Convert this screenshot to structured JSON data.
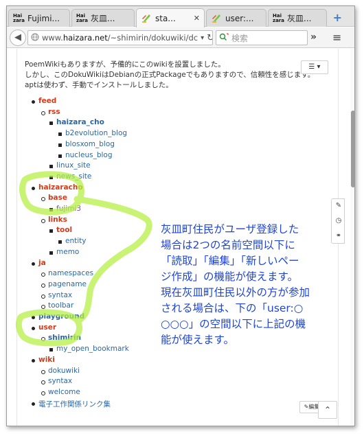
{
  "browser": {
    "tabs": [
      {
        "favicon": "haizara-icon",
        "favicon_text": [
          "Hai",
          "zara"
        ],
        "label": "Fujimi...",
        "active": false
      },
      {
        "favicon": "haizara-icon",
        "favicon_text": [
          "Hai",
          "zara"
        ],
        "label": "灰皿...",
        "active": false
      },
      {
        "favicon": "wiki-icon",
        "label": "sta...",
        "active": true
      },
      {
        "favicon": "wiki-icon",
        "label": "user:...",
        "active": false
      },
      {
        "favicon": "haizara-icon",
        "favicon_text": [
          "Hai",
          "zara"
        ],
        "label": "灰皿...",
        "active": false
      }
    ],
    "tab_close": "✕",
    "new_tab": "+",
    "url_prefix": "www.",
    "url_host": "haizara.net",
    "url_path": "/~shimirin/dokuwiki/dc",
    "search_placeholder": "検索",
    "more": "»",
    "menu": "≡"
  },
  "page": {
    "intro_lines": [
      "PoemWikiもありますが、予備的にこのwikiを設置しました。",
      "しかし、このDokuWikiはDebianの正式Packageでもありますので、信頼性を感じます。",
      "aptは使わず、手動でインストールしました。"
    ],
    "toc_button": "☰ ▾",
    "edit_button": "✎編集",
    "top_button": "⌃"
  },
  "tree": [
    {
      "level": 1,
      "label": "feed",
      "style": "red"
    },
    {
      "level": 2,
      "label": "rss",
      "style": "red"
    },
    {
      "level": 3,
      "label": "haizara_cho",
      "style": "blue-bold"
    },
    {
      "level": 4,
      "label": "b2evolution_blog",
      "style": "blue"
    },
    {
      "level": 4,
      "label": "blosxom_blog",
      "style": "blue"
    },
    {
      "level": 4,
      "label": "nucleus_blog",
      "style": "blue"
    },
    {
      "level": 3,
      "label": "linux_site",
      "style": "blue"
    },
    {
      "level": 3,
      "label": "news_site",
      "style": "blue"
    },
    {
      "level": 1,
      "label": "haizaracho",
      "style": "red"
    },
    {
      "level": 2,
      "label": "base",
      "style": "red"
    },
    {
      "level": 3,
      "label": "fujimi3",
      "style": "purple"
    },
    {
      "level": 2,
      "label": "links",
      "style": "red"
    },
    {
      "level": 3,
      "label": "tool",
      "style": "red"
    },
    {
      "level": 4,
      "label": "entity",
      "style": "blue"
    },
    {
      "level": 3,
      "label": "memo",
      "style": "blue"
    },
    {
      "level": 1,
      "label": "ja",
      "style": "red"
    },
    {
      "level": 2,
      "label": "namespaces",
      "style": "blue"
    },
    {
      "level": 2,
      "label": "pagename",
      "style": "blue"
    },
    {
      "level": 2,
      "label": "syntax",
      "style": "blue"
    },
    {
      "level": 2,
      "label": "toolbar",
      "style": "blue"
    },
    {
      "level": 1,
      "label": "playground",
      "style": "blue-bold"
    },
    {
      "level": 1,
      "label": "user",
      "style": "red"
    },
    {
      "level": 2,
      "label": "shimirin",
      "style": "blue-bold"
    },
    {
      "level": 3,
      "label": "my_open_bookmark",
      "style": "blue"
    },
    {
      "level": 1,
      "label": "wiki",
      "style": "red"
    },
    {
      "level": 2,
      "label": "dokuwiki",
      "style": "blue"
    },
    {
      "level": 2,
      "label": "syntax",
      "style": "blue"
    },
    {
      "level": 2,
      "label": "welcome",
      "style": "blue"
    },
    {
      "level": 1,
      "label": "電子工作関係リンク集",
      "style": "blue"
    }
  ],
  "annotation": {
    "lines": [
      "灰皿町住民がユーザ登録した",
      "場合は2つの名前空間以下に",
      "「読取」「編集」「新しいペー",
      "ジ作成」の機能が使えます。",
      "現在灰皿町住民以外の方が参加",
      "される場合は、下の「user:○",
      "○○○」の空間以下に上記の機",
      "能が使えます。"
    ],
    "text_color": "#1f44d8",
    "highlight_color": "#b6ef46"
  }
}
